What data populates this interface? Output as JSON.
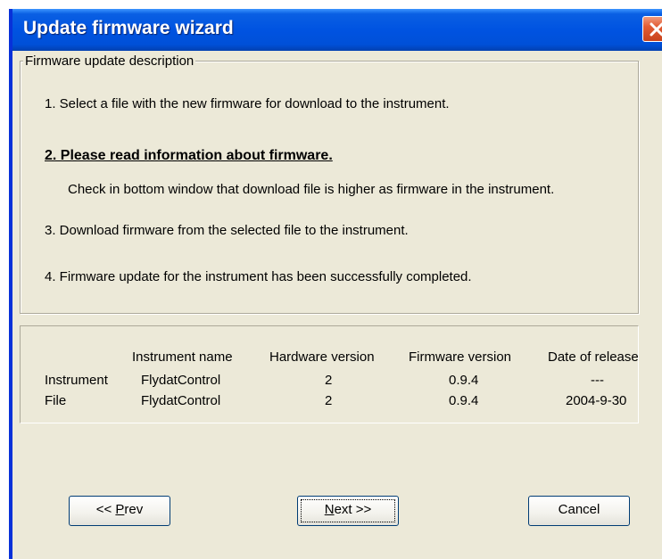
{
  "window": {
    "title": "Update firmware wizard"
  },
  "description": {
    "legend": "Firmware update description",
    "step1": "1. Select a file with the new firmware for download to the instrument.",
    "step2": "2. Please read information about firmware.",
    "step2_detail": "Check in bottom window that download file is higher as firmware in the instrument.",
    "step3": "3. Download firmware from the selected file to the instrument.",
    "step4": "4. Firmware update for the instrument has been successfully completed."
  },
  "info_table": {
    "columns": [
      "",
      "Instrument name",
      "Hardware version",
      "Firmware version",
      "Date of release"
    ],
    "rows": [
      [
        "Instrument",
        "FlydatControl",
        "2",
        "0.9.4",
        "---"
      ],
      [
        "File",
        "FlydatControl",
        "2",
        "0.9.4",
        "2004-9-30"
      ]
    ]
  },
  "buttons": {
    "prev_prefix": "<< ",
    "prev_mnemonic": "P",
    "prev_rest": "rev",
    "next_mnemonic": "N",
    "next_rest": "ext >>",
    "cancel": "Cancel"
  },
  "colors": {
    "titlebar": "#0053e1",
    "dialog_bg": "#ece9d8",
    "close_button": "#e25c34"
  },
  "icons": {
    "close": "close-icon"
  }
}
